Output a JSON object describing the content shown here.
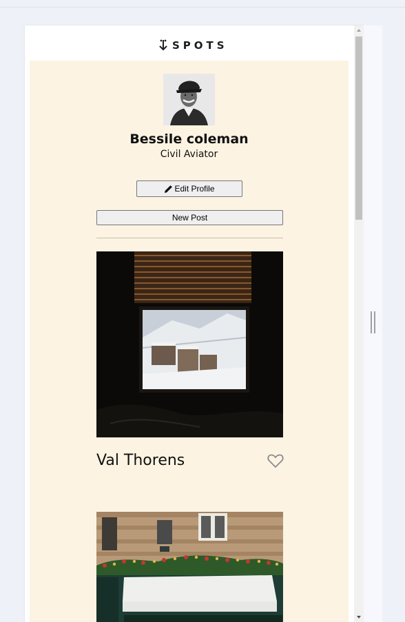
{
  "header": {
    "logo_text": "SPOTS",
    "logo_icon": "down-arrow-dots-icon"
  },
  "profile": {
    "name": "Bessile coleman",
    "job": "Civil Aviator",
    "avatar": "profile-photo"
  },
  "actions": {
    "edit_label": "Edit Profile",
    "edit_icon": "pencil-icon",
    "new_post_label": "New Post",
    "new_post_icon": "plus-icon"
  },
  "cards": [
    {
      "title": "Val Thorens",
      "image": "window-snowy-town-photo",
      "liked": false
    },
    {
      "title": "",
      "image": "restaurant-storefront-photo",
      "liked": false
    }
  ],
  "colors": {
    "content_bg": "#fcf3e3",
    "page_bg": "#eef1f8",
    "text": "#111111"
  }
}
